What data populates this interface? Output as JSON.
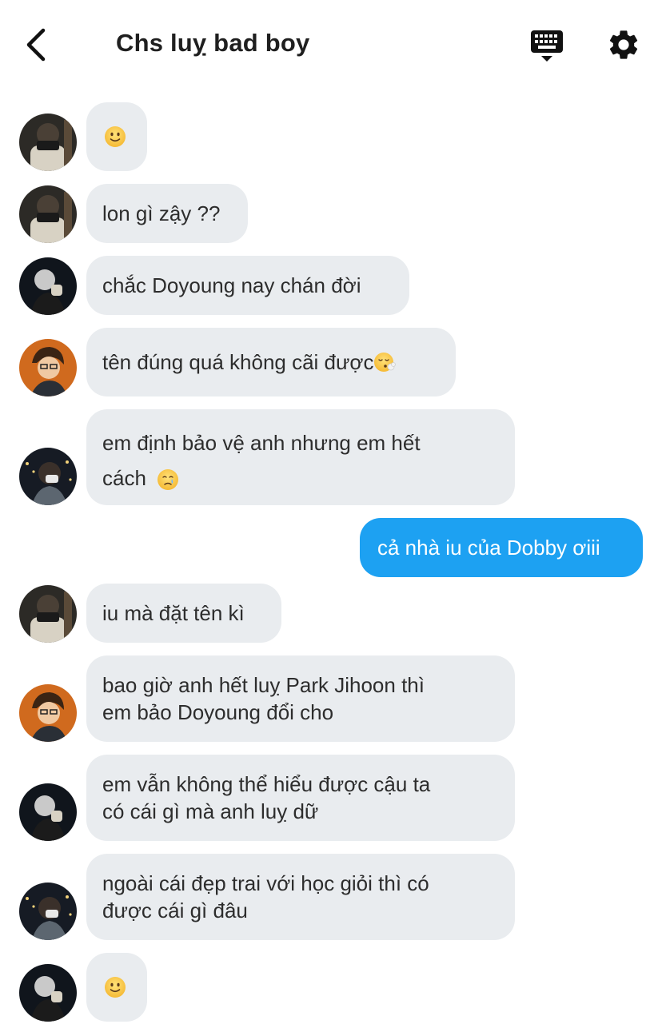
{
  "header": {
    "title": "Chs luỵ bad boy",
    "back_icon": "chevron-left-icon",
    "keyboard_icon": "keyboard-icon",
    "settings_icon": "gear-icon"
  },
  "messages": [
    {
      "sender": "other",
      "avatar": "avatar-1",
      "text": ""
    },
    {
      "sender": "other",
      "avatar": "avatar-1",
      "text": "lon gì zậy ??"
    },
    {
      "sender": "other",
      "avatar": "avatar-2",
      "text": "chắc Doyoung nay chán đời"
    },
    {
      "sender": "other",
      "avatar": "avatar-3",
      "text": "tên đúng quá không cãi được"
    },
    {
      "sender": "other",
      "avatar": "avatar-4",
      "text_line1": "em định bảo vệ anh nhưng em hết",
      "text_line2": "cách"
    },
    {
      "sender": "me",
      "text": "cả nhà iu của Dobby ơiii"
    },
    {
      "sender": "other",
      "avatar": "avatar-1",
      "text": "iu mà đặt tên kì"
    },
    {
      "sender": "other",
      "avatar": "avatar-3",
      "text_line1": "bao giờ anh hết luỵ Park Jihoon thì",
      "text_line2": "em bảo Doyoung đổi cho"
    },
    {
      "sender": "other",
      "avatar": "avatar-2",
      "text_line1": "em vẫn không thể hiểu được cậu ta",
      "text_line2": "có cái gì mà anh luỵ dữ"
    },
    {
      "sender": "other",
      "avatar": "avatar-4",
      "text_line1": "ngoài cái đẹp trai với học giỏi thì có",
      "text_line2": "được cái gì đâu"
    },
    {
      "sender": "other",
      "avatar": "avatar-2",
      "text": ""
    }
  ],
  "colors": {
    "bubble_other": "#e9ecef",
    "bubble_me": "#1da1f2",
    "text": "#2d2d2d"
  }
}
